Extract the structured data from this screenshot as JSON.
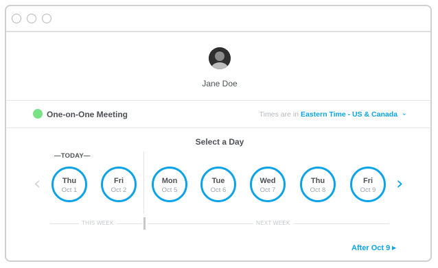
{
  "window": {
    "controls": [
      "close",
      "minimize",
      "maximize"
    ]
  },
  "profile": {
    "name": "Jane Doe",
    "avatar_icon": "user-photo"
  },
  "event": {
    "name": "One-on-One Meeting",
    "status_color": "#79e286",
    "timezone_prefix": "Times are in",
    "timezone": "Eastern Time - US & Canada",
    "timezone_chevron": "⌄"
  },
  "calendar": {
    "title": "Select a Day",
    "today_label": "—TODAY—",
    "prev_arrow": "‹",
    "next_arrow": "›",
    "days": [
      {
        "name": "Thu",
        "date": "Oct 1"
      },
      {
        "name": "Fri",
        "date": "Oct 2"
      },
      {
        "name": "Mon",
        "date": "Oct 5"
      },
      {
        "name": "Tue",
        "date": "Oct 6"
      },
      {
        "name": "Wed",
        "date": "Oct 7"
      },
      {
        "name": "Thu",
        "date": "Oct 8"
      },
      {
        "name": "Fri",
        "date": "Oct 9"
      }
    ],
    "this_week_label": "THIS WEEK",
    "next_week_label": "NEXT WEEK",
    "after_link": "After Oct 9",
    "after_caret": "▶"
  },
  "colors": {
    "accent": "#0aa3e8",
    "text": "#4d5055",
    "muted": "#9da1a6"
  }
}
